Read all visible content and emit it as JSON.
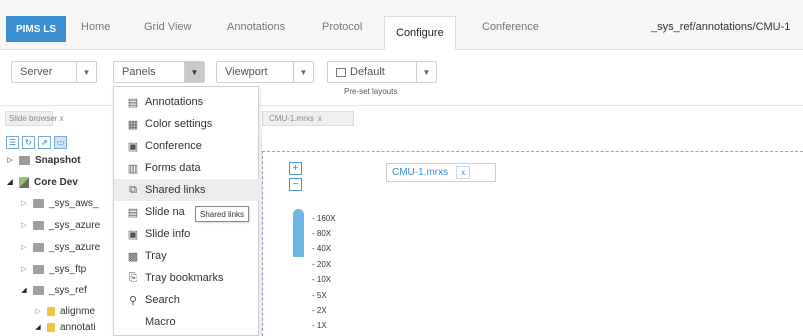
{
  "nav": {
    "brand": "PIMS LS",
    "tabs": [
      "Home",
      "Grid View",
      "Annotations",
      "Protocol",
      "Configure",
      "Conference"
    ],
    "active_tab": "Configure",
    "breadcrumb": "_sys_ref/annotations/CMU-1",
    "brand_color": "#3a8fd3"
  },
  "toolbar": {
    "server": "Server",
    "panels": "Panels",
    "viewport": "Viewport",
    "default": "Default",
    "preset_caption": "Pre-set layouts"
  },
  "slide_browser": {
    "tab_label": "Slide browser",
    "close": "x",
    "icons": [
      "list-icon",
      "refresh-icon",
      "share-icon",
      "image-icon"
    ],
    "tree": [
      {
        "label": "Snapshot",
        "bold": true,
        "expanded": false
      },
      {
        "label": "Core Dev",
        "bold": true,
        "expanded": true
      },
      {
        "label": "_sys_aws_",
        "expanded": false
      },
      {
        "label": "_sys_azure",
        "expanded": false
      },
      {
        "label": "_sys_azure",
        "expanded": false
      },
      {
        "label": "_sys_ftp",
        "expanded": false
      },
      {
        "label": "_sys_ref",
        "expanded": true
      },
      {
        "label": "alignme",
        "expanded": false
      },
      {
        "label": "annotati",
        "expanded": true
      }
    ]
  },
  "viewer": {
    "tab_label": "CMU-1.mrxs",
    "close": "x",
    "slide_label": "CMU-1.mrxs",
    "slide_close": "x",
    "zoom_in": "+",
    "zoom_out": "−",
    "zoom_levels": [
      "160X",
      "80X",
      "40X",
      "20X",
      "10X",
      "5X",
      "2X",
      "1X"
    ],
    "zoom_fill_fraction": 0.38
  },
  "panels_menu": {
    "items": [
      {
        "label": "Annotations",
        "icon": "annotations-icon"
      },
      {
        "label": "Color settings",
        "icon": "color-settings-icon"
      },
      {
        "label": "Conference",
        "icon": "conference-icon"
      },
      {
        "label": "Forms data",
        "icon": "forms-data-icon"
      },
      {
        "label": "Shared links",
        "icon": "shared-links-icon",
        "hover": true
      },
      {
        "label": "Slide na",
        "icon": "slide-nav-icon"
      },
      {
        "label": "Slide info",
        "icon": "slide-info-icon"
      },
      {
        "label": "Tray",
        "icon": "tray-icon"
      },
      {
        "label": "Tray bookmarks",
        "icon": "tray-bookmarks-icon"
      },
      {
        "label": "Search",
        "icon": "search-icon"
      },
      {
        "label": "Macro",
        "icon": ""
      }
    ],
    "tooltip": "Shared links"
  }
}
